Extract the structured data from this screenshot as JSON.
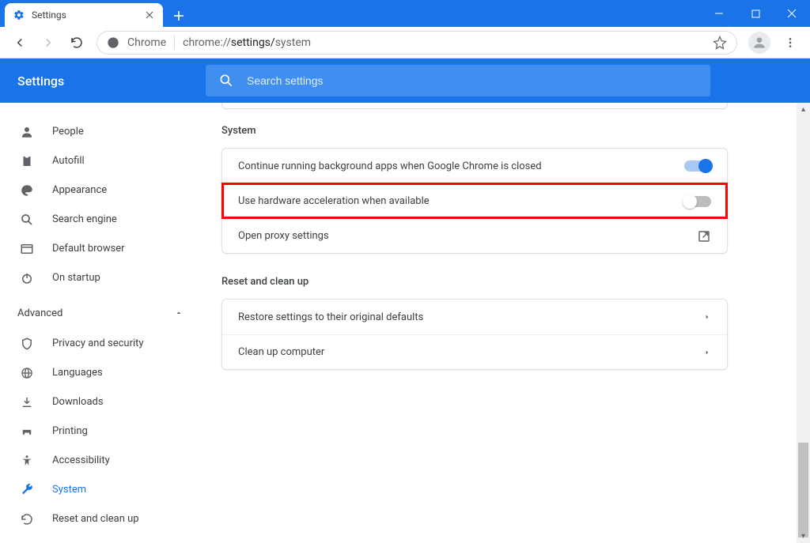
{
  "window": {
    "tab_title": "Settings",
    "omnibox_prefix": "Chrome",
    "omnibox_host": "chrome://",
    "omnibox_path1": "settings/",
    "omnibox_path2": "system"
  },
  "header": {
    "title": "Settings",
    "search_placeholder": "Search settings"
  },
  "sidebar": {
    "items_main": [
      {
        "label": "People"
      },
      {
        "label": "Autofill"
      },
      {
        "label": "Appearance"
      },
      {
        "label": "Search engine"
      },
      {
        "label": "Default browser"
      },
      {
        "label": "On startup"
      }
    ],
    "advanced_label": "Advanced",
    "items_adv": [
      {
        "label": "Privacy and security"
      },
      {
        "label": "Languages"
      },
      {
        "label": "Downloads"
      },
      {
        "label": "Printing"
      },
      {
        "label": "Accessibility"
      },
      {
        "label": "System"
      },
      {
        "label": "Reset and clean up"
      }
    ]
  },
  "sections": {
    "system": {
      "heading": "System",
      "rows": [
        {
          "label": "Continue running background apps when Google Chrome is closed",
          "toggle": true
        },
        {
          "label": "Use hardware acceleration when available",
          "toggle": false
        },
        {
          "label": "Open proxy settings"
        }
      ]
    },
    "reset": {
      "heading": "Reset and clean up",
      "rows": [
        {
          "label": "Restore settings to their original defaults"
        },
        {
          "label": "Clean up computer"
        }
      ]
    }
  }
}
